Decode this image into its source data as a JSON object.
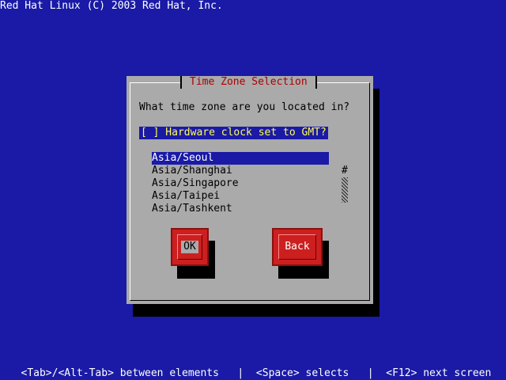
{
  "screen": {
    "title": "Red Hat Linux (C) 2003 Red Hat, Inc.",
    "help_line": " <Tab>/<Alt-Tab> between elements   |  <Space> selects   |  <F12> next screen"
  },
  "dialog": {
    "title": "Time Zone Selection",
    "question": "What time zone are you located in?",
    "gmt_checkbox": {
      "label": "[ ] Hardware clock set to GMT?",
      "checked": false
    },
    "timezones": [
      "Asia/Seoul",
      "Asia/Shanghai",
      "Asia/Singapore",
      "Asia/Taipei",
      "Asia/Tashkent"
    ],
    "selected_timezone": "Asia/Seoul",
    "scrollbar_thumb": "#",
    "buttons": {
      "ok_label": "OK",
      "back_label": "Back"
    }
  },
  "colors": {
    "background": "#1a1aa6",
    "dialog_bg": "#aaaaaa",
    "title_text": "#aa0000",
    "button_bg": "#cc1f1f",
    "checkbox_text": "#ffff55"
  }
}
